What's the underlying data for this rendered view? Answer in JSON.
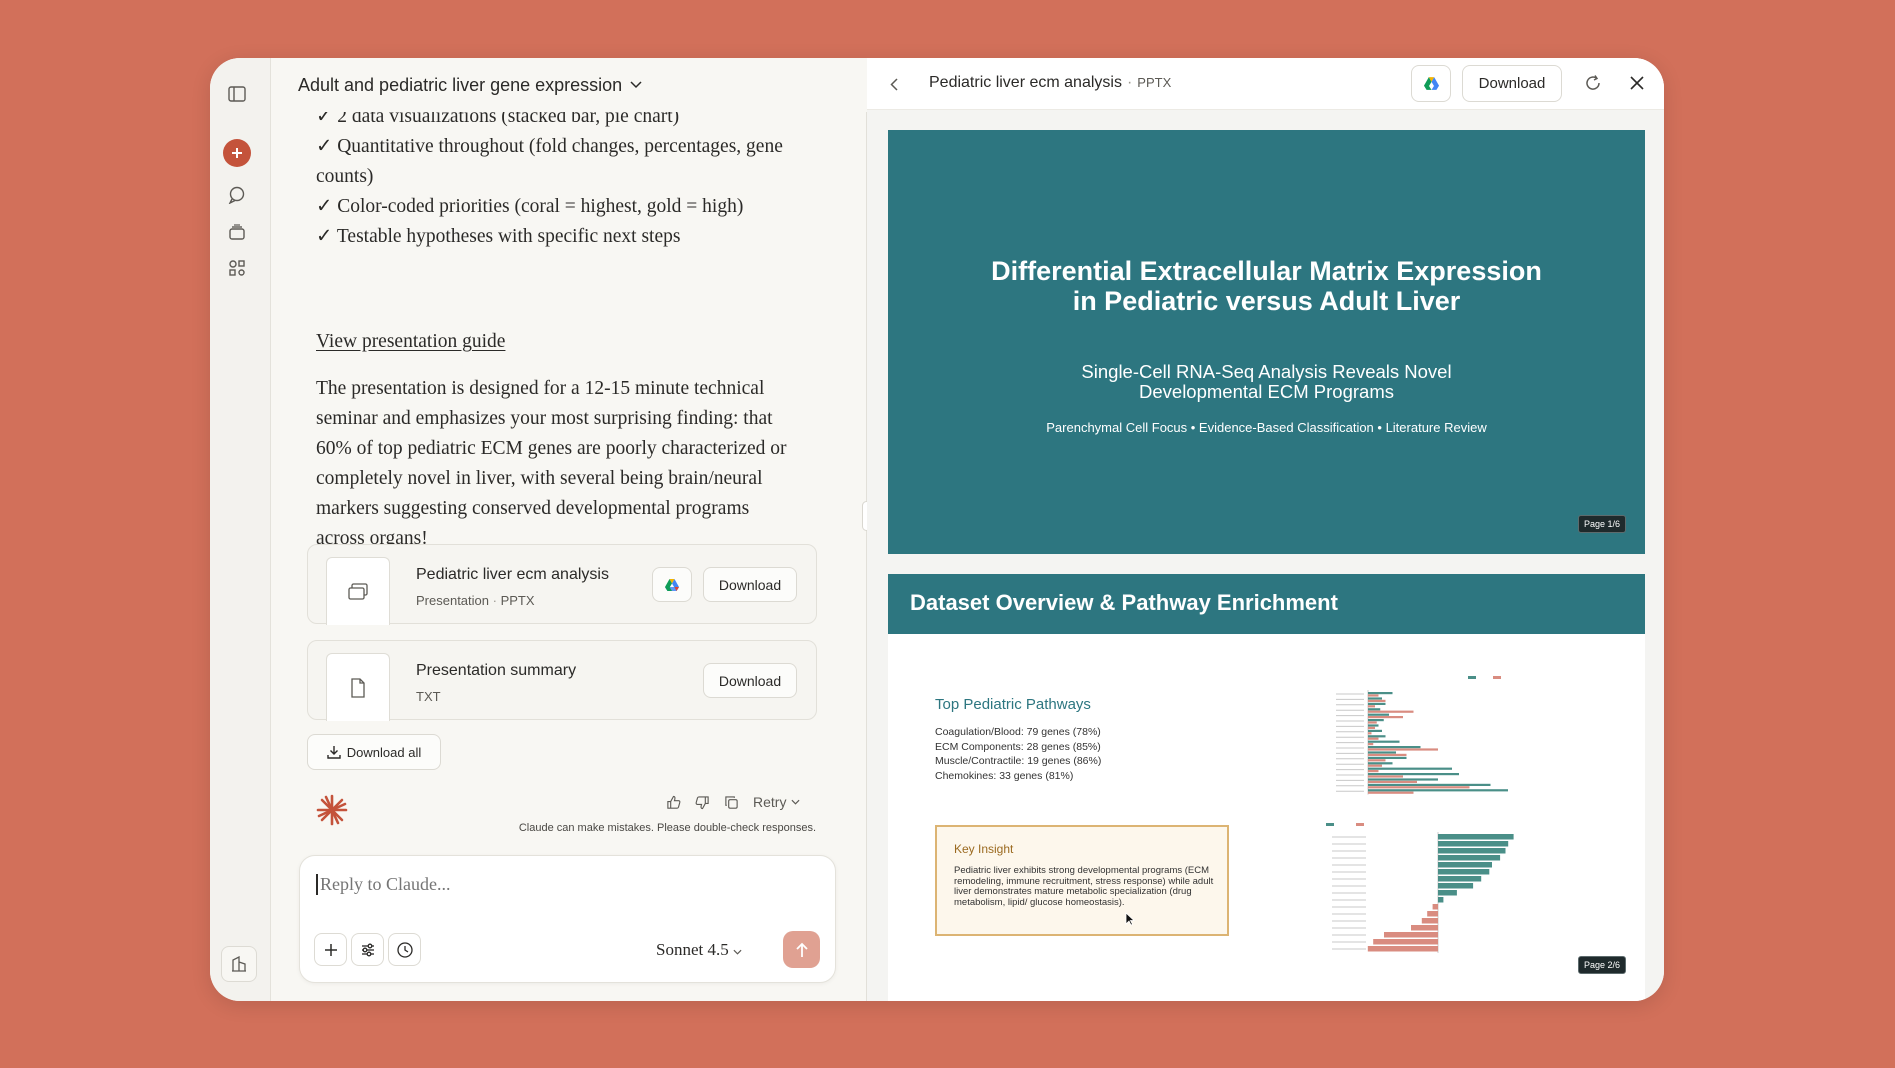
{
  "chat": {
    "title": "Adult and pediatric liver gene expression",
    "bullets": [
      "✓ 2 data visualizations (stacked bar, pie chart)",
      "✓ Quantitative throughout (fold changes, percentages, gene counts)",
      "✓ Color-coded priorities (coral = highest, gold = high)",
      "✓ Testable hypotheses with specific next steps"
    ],
    "guide_link": "View presentation guide",
    "paragraph": "The presentation is designed for a 12-15 minute technical seminar and emphasizes your most surprising finding: that 60% of top pediatric ECM genes are poorly characterized or completely novel in liver, with several being brain/neural markers suggesting conserved developmental programs across organs!",
    "files": [
      {
        "name": "Pediatric liver ecm analysis",
        "kind": "Presentation",
        "ext": "PPTX",
        "download_label": "Download",
        "icon": "presentation-icon"
      },
      {
        "name": "Presentation summary",
        "kind": "",
        "ext": "TXT",
        "download_label": "Download",
        "icon": "document-icon"
      }
    ],
    "download_all": "Download all",
    "retry_label": "Retry",
    "disclaimer": "Claude can make mistakes. Please double-check responses.",
    "composer": {
      "placeholder": "Reply to Claude...",
      "model": "Sonnet 4.5"
    }
  },
  "preview": {
    "title": "Pediatric liver ecm analysis",
    "separator": "·",
    "type": "PPTX",
    "download_label": "Download",
    "slide1": {
      "title": "Differential Extracellular Matrix Expression\nin Pediatric versus Adult Liver",
      "subtitle": "Single-Cell RNA-Seq Analysis Reveals Novel\nDevelopmental ECM Programs",
      "tags": "Parenchymal Cell Focus • Evidence-Based Classification • Literature Review",
      "page": "Page 1/6"
    },
    "slide2": {
      "title": "Dataset Overview & Pathway Enrichment",
      "pathways_title": "Top Pediatric Pathways",
      "pathways": [
        "Coagulation/Blood: 79 genes (78%)",
        "ECM Components: 28 genes (85%)",
        "Muscle/Contractile: 19 genes (86%)",
        "Chemokines: 33 genes (81%)"
      ],
      "insight_title": "Key Insight",
      "insight_text": "Pediatric liver exhibits strong developmental programs (ECM remodeling, immune recruitment, stress response) while adult liver demonstrates mature metabolic specialization (drug metabolism, lipid/ glucose homeostasis).",
      "page": "Page 2/6"
    }
  },
  "colors": {
    "background": "#d2705a",
    "accent": "#c4533b",
    "slide_teal": "#2d7680",
    "chart_teal": "#4a8f88",
    "chart_coral": "#d98c80",
    "insight_border": "#dcb473"
  },
  "chart_data": [
    {
      "type": "bar",
      "orientation": "horizontal",
      "series": [
        {
          "name": "pediatric",
          "values": [
            14,
            8,
            10,
            7,
            12,
            9,
            6,
            8,
            10,
            18,
            30,
            16,
            22,
            14,
            48,
            52,
            40,
            70,
            80
          ]
        },
        {
          "name": "adult",
          "values": [
            6,
            10,
            4,
            26,
            20,
            5,
            4,
            2,
            6,
            3,
            40,
            22,
            10,
            8,
            6,
            20,
            28,
            58,
            26
          ]
        }
      ]
    },
    {
      "type": "bar",
      "orientation": "horizontal",
      "values": [
        28,
        26,
        25,
        23,
        20,
        19,
        16,
        13,
        7,
        2,
        -2,
        -4,
        -6,
        -10,
        -20,
        -24,
        -26
      ]
    }
  ]
}
